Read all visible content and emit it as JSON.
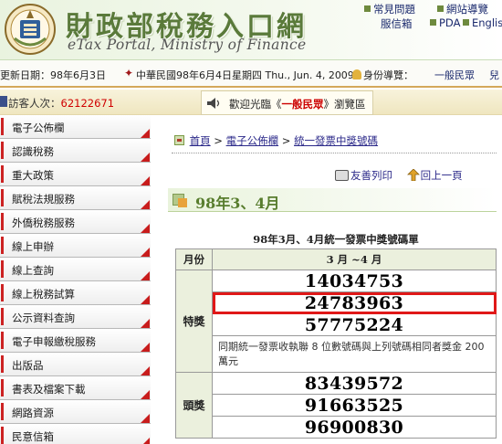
{
  "header": {
    "title_cn": "財政部稅務入口網",
    "title_en": "eTax Portal, Ministry of Finance",
    "links": {
      "faq": "常見問題",
      "sitemap": "網站導覽",
      "mailbox": "服信箱",
      "pda": "PDA",
      "english": "English"
    }
  },
  "infobar": {
    "updated": "更新日期：98年6月3日",
    "today": "中華民國98年6月4日星期四 Thu., Jun. 4, 2009",
    "identity_label": "身份導覽：",
    "identity_value": "一般民眾",
    "extra": "兒"
  },
  "visitor": {
    "label": "訪客人次：",
    "count": "62122671"
  },
  "welcome": {
    "prefix": "歡迎光臨《",
    "role": "一般民眾",
    "suffix": "》瀏覽區"
  },
  "sidebar": {
    "items": [
      {
        "label": "電子公佈欄"
      },
      {
        "label": "認識稅務"
      },
      {
        "label": "重大政策"
      },
      {
        "label": "賦稅法規服務"
      },
      {
        "label": "外僑稅務服務"
      },
      {
        "label": "線上申辦"
      },
      {
        "label": "線上查詢"
      },
      {
        "label": "線上稅務試算"
      },
      {
        "label": "公示資料查詢"
      },
      {
        "label": "電子申報繳稅服務"
      },
      {
        "label": "出版品"
      },
      {
        "label": "書表及檔案下載"
      },
      {
        "label": "網路資源"
      },
      {
        "label": "民意信箱"
      }
    ]
  },
  "breadcrumb": {
    "home": "首頁",
    "sep1": " > ",
    "board": "電子公佈欄",
    "sep2": " > ",
    "current": "統一發票中獎號碼"
  },
  "actions": {
    "print": "友善列印",
    "up": "回上一頁"
  },
  "period": {
    "title": "98年3、4月"
  },
  "table": {
    "caption": "98年3月、4月統一發票中獎號碼單",
    "header_month": "月份",
    "header_period": "3 月 ~4 月",
    "special_label": "特獎",
    "special_numbers": [
      "14034753",
      "24783963",
      "57775224"
    ],
    "special_note": "同期統一發票收執聯 8 位數號碼與上列號碼相同者獎金 200 萬元",
    "first_label": "頭獎",
    "first_numbers": [
      "83439572",
      "91663525",
      "96900830"
    ]
  }
}
